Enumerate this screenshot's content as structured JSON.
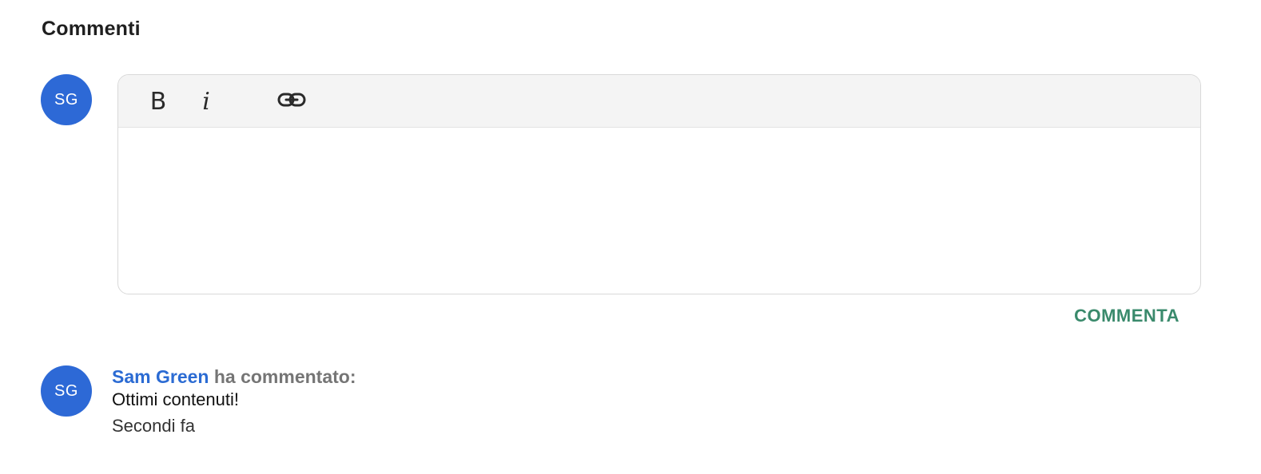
{
  "section": {
    "title": "Commenti"
  },
  "current_user": {
    "initials": "SG"
  },
  "editor": {
    "toolbar": {
      "bold_label": "B",
      "italic_label": "i",
      "link_icon": "link-icon"
    },
    "value": "",
    "submit_label": "COMMENTA"
  },
  "comments": [
    {
      "initials": "SG",
      "author": "Sam Green",
      "action": "ha commentato:",
      "text": "Ottimi contenuti!",
      "time": "Secondi fa"
    }
  ],
  "colors": {
    "avatar": "#2d69d6",
    "author_link": "#2b6bd3",
    "submit": "#3a8a6c",
    "toolbar_bg": "#f4f4f4"
  }
}
